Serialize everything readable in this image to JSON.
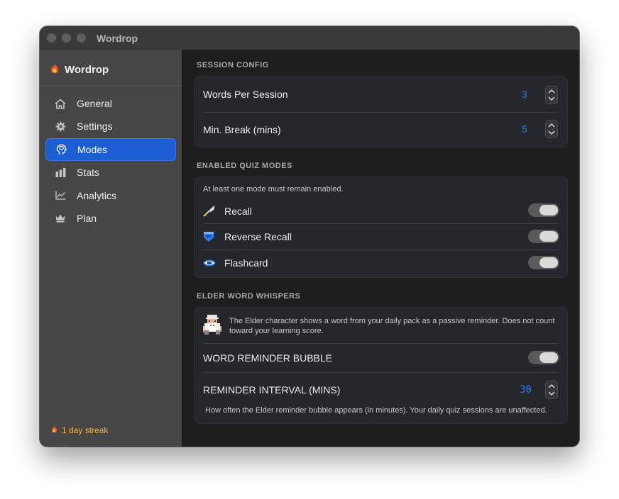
{
  "window": {
    "title": "Wordrop"
  },
  "sidebar": {
    "brand": "Wordrop",
    "items": [
      {
        "label": "General",
        "icon": "house-icon"
      },
      {
        "label": "Settings",
        "icon": "gear-icon"
      },
      {
        "label": "Modes",
        "icon": "brain-icon",
        "active": true
      },
      {
        "label": "Stats",
        "icon": "bar-chart-icon"
      },
      {
        "label": "Analytics",
        "icon": "line-chart-icon"
      },
      {
        "label": "Plan",
        "icon": "crown-icon"
      }
    ],
    "streak": "1 day streak"
  },
  "session_config": {
    "title": "SESSION CONFIG",
    "words_per_session": {
      "label": "Words Per Session",
      "value": "3"
    },
    "min_break": {
      "label": "Min. Break (mins)",
      "value": "5"
    }
  },
  "quiz_modes": {
    "title": "ENABLED QUIZ MODES",
    "note": "At least one mode must remain enabled.",
    "modes": [
      {
        "label": "Recall",
        "icon": "quill-icon",
        "enabled": true
      },
      {
        "label": "Reverse Recall",
        "icon": "shield-icon",
        "enabled": true
      },
      {
        "label": "Flashcard",
        "icon": "eye-icon",
        "enabled": true
      }
    ]
  },
  "elder": {
    "title": "ELDER WORD WHISPERS",
    "description": "The Elder character shows a word from your daily pack as a passive reminder. Does not count toward your learning score.",
    "bubble": {
      "label": "WORD REMINDER BUBBLE",
      "enabled": true
    },
    "interval": {
      "label": "REMINDER INTERVAL (MINS)",
      "value": "30"
    },
    "footnote": "How often the Elder reminder bubble appears (in minutes). Your daily quiz sessions are unaffected."
  },
  "colors": {
    "accent": "#1d5ed4",
    "value_blue": "#2f7cf0",
    "streak": "#f2b33b"
  }
}
